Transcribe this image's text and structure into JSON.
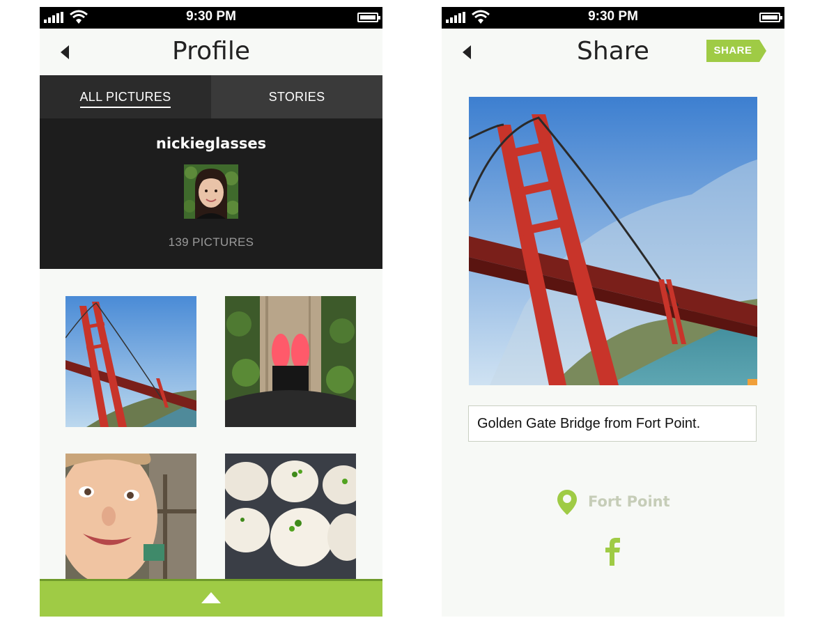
{
  "colors": {
    "accent_green": "#9fcb45",
    "dark_header": "#1d1d1d",
    "tab_bg": "#2b2b2b",
    "screen_bg": "#f7f9f6",
    "location_text": "#c6cdb8"
  },
  "left_screen": {
    "status_bar": {
      "time": "9:30 PM",
      "icons": [
        "signal-icon",
        "wifi-icon",
        "battery-icon"
      ]
    },
    "nav": {
      "title": "Profile",
      "back_icon": "back-arrow-icon"
    },
    "tabs": [
      {
        "label": "ALL PICTURES",
        "active": true
      },
      {
        "label": "STORIES",
        "active": false
      }
    ],
    "profile": {
      "username": "nickieglasses",
      "picture_count": "139 PICTURES"
    },
    "thumbnails": [
      "golden-gate-bridge",
      "red-sneakers-on-log",
      "smiling-child",
      "steamed-buns"
    ],
    "bottom_bar": {
      "icon": "chevron-up-icon"
    }
  },
  "right_screen": {
    "status_bar": {
      "time": "9:30 PM",
      "icons": [
        "signal-icon",
        "wifi-icon",
        "battery-icon"
      ]
    },
    "nav": {
      "title": "Share",
      "back_icon": "back-arrow-icon",
      "share_label": "SHARE"
    },
    "photo": "golden-gate-bridge",
    "caption": "Golden Gate Bridge from Fort Point.",
    "location": "Fort Point",
    "social_icon": "facebook-icon"
  }
}
